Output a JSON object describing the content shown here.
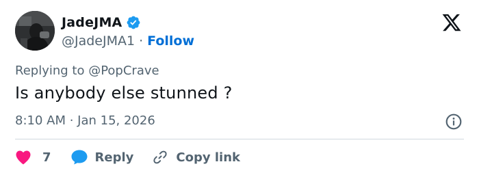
{
  "author": {
    "display_name": "JadeJMA",
    "handle": "@JadeJMA1",
    "separator": "·",
    "follow_label": "Follow",
    "verified": true
  },
  "replying": {
    "prefix": "Replying to ",
    "handle": "@PopCrave"
  },
  "tweet": {
    "text": "Is anybody else stunned ?",
    "timestamp": "8:10 AM · Jan 15, 2026"
  },
  "actions": {
    "like_count": "7",
    "reply_label": "Reply",
    "copy_link_label": "Copy link"
  },
  "colors": {
    "link_blue": "#006fd6",
    "verified_blue": "#1d9bf0",
    "like_pink": "#f91880",
    "reply_blue": "#1d9bf0",
    "muted_gray": "#536471",
    "text_dark": "#0f1419",
    "divider": "#cfd9de"
  },
  "icons": [
    "avatar-image",
    "verified-badge-icon",
    "x-logo-icon",
    "info-icon",
    "heart-icon",
    "reply-bubble-icon",
    "link-icon"
  ]
}
